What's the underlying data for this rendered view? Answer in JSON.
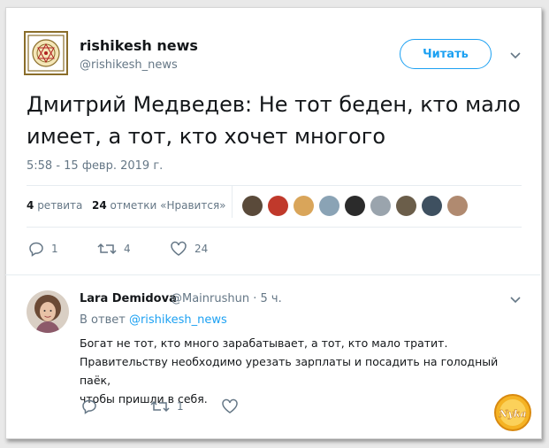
{
  "tweet": {
    "author_name": "rishikesh news",
    "author_handle": "@rishikesh_news",
    "follow_label": "Читать",
    "text": "Дмитрий Медведев: Не тот беден, кто мало имеет, а тот, кто хочет многого",
    "timestamp": "5:58 - 15 февр. 2019 г.",
    "retweets_count": "4",
    "retweets_label": "ретвита",
    "likes_count": "24",
    "likes_label": "отметки «Нравится»",
    "actions": {
      "reply_count": "1",
      "retweet_count": "4",
      "like_count": "24"
    },
    "likers_colors": [
      "#5a4a3a",
      "#c0392b",
      "#d9a55a",
      "#8aa3b5",
      "#2b2b2b",
      "#9aa4ad",
      "#6b5e4a",
      "#3e5060",
      "#b08a70"
    ]
  },
  "reply": {
    "author_name": "Lara Demidova",
    "author_handle": "@Mainrushun · 5 ч.",
    "reply_prefix": "В ответ",
    "reply_target": "@rishikesh_news",
    "text_lines": [
      "Богат не тот, кто много зарабатывает, а тот, кто мало тратит.",
      "Правительству необходимо урезать зарплаты и посадить на голодный паёк,",
      "чтобы пришли в себя."
    ],
    "actions": {
      "retweet_count": "1"
    }
  },
  "watermark": {
    "text": "Nyka",
    "color": "#f0a020"
  },
  "colors": {
    "accent": "#1da1f2",
    "text": "#14171a",
    "muted": "#657786"
  }
}
